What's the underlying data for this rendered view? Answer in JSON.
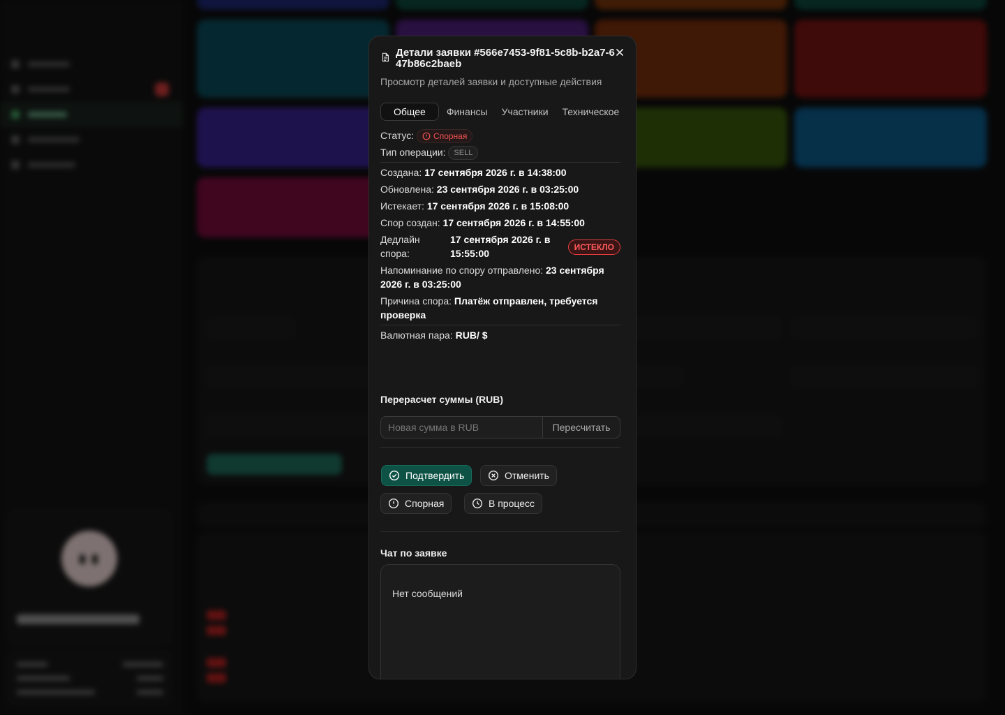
{
  "modal": {
    "title": "Детали заявки #566e7453-9f81-5c8b-b2a7-647b86c2baeb",
    "subtitle": "Просмотр деталей заявки и доступные действия",
    "tabs": [
      {
        "label": "Общее",
        "active": true
      },
      {
        "label": "Финансы",
        "active": false
      },
      {
        "label": "Участники",
        "active": false
      },
      {
        "label": "Техническое",
        "active": false
      }
    ],
    "status_label": "Статус:",
    "status_value": "Спорная",
    "op_type_label": "Тип операции:",
    "op_type_value": "SELL",
    "created_label": "Создана:",
    "created_value": "17 сентября 2026 г. в 14:38:00",
    "updated_label": "Обновлена:",
    "updated_value": "23 сентября 2026 г. в 03:25:00",
    "expires_label": "Истекает:",
    "expires_value": "17 сентября 2026 г. в 15:08:00",
    "dispute_created_label": "Спор создан:",
    "dispute_created_value": "17 сентября 2026 г. в 14:55:00",
    "dispute_deadline_label": "Дедлайн спора:",
    "dispute_deadline_value": "17 сентября 2026 г. в 15:55:00",
    "expired_badge": "ИСТЕКЛО",
    "reminder_label": "Напоминание по спору отправлено:",
    "reminder_value": "23 сентября 2026 г. в 03:25:00",
    "reason_label": "Причина спора:",
    "reason_value": "Платёж отправлен, требуется проверка",
    "pair_label": "Валютная пара:",
    "pair_value": "RUB/ $",
    "recalc_title": "Перерасчет суммы (RUB)",
    "recalc_placeholder": "Новая сумма в RUB",
    "recalc_button": "Пересчитать",
    "actions": {
      "confirm": "Подтвердить",
      "cancel": "Отменить",
      "dispute": "Спорная",
      "in_process": "В процесс"
    },
    "chat_title": "Чат по заявке",
    "chat_empty": "Нет сообщений"
  },
  "colors": {
    "accent": "#0e5246",
    "danger": "#ef5350",
    "background": "#181818"
  }
}
